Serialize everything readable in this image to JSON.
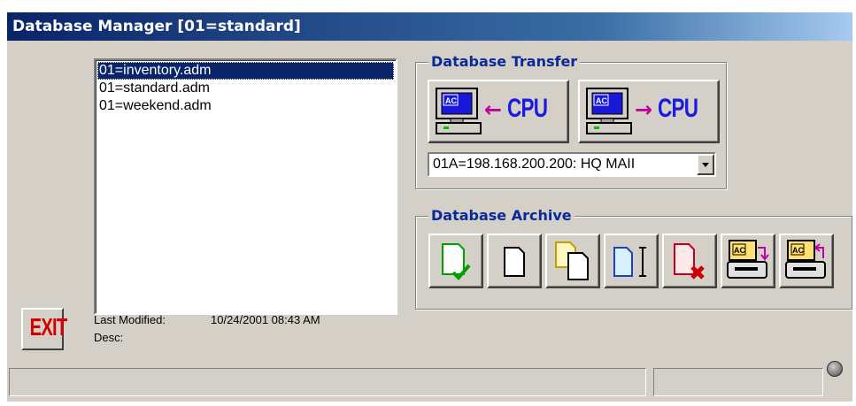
{
  "window": {
    "title": "Database Manager  [01=standard]"
  },
  "file_list": {
    "items": [
      {
        "label": "01=inventory.adm",
        "selected": true
      },
      {
        "label": "01=standard.adm",
        "selected": false
      },
      {
        "label": "01=weekend.adm",
        "selected": false
      }
    ]
  },
  "transfer": {
    "group_label": "Database Transfer",
    "to_pc_text": "CPU",
    "to_cpu_text": "CPU",
    "pc_screen_text": "AC",
    "target_select": {
      "value": "01A=198.168.200.200: HQ MAII"
    }
  },
  "archive": {
    "group_label": "Database Archive",
    "disk_label": "AC"
  },
  "exit": {
    "label": "EXIT"
  },
  "info": {
    "last_modified_label": "Last Modified:",
    "last_modified_value": "10/24/2001 08:43 AM",
    "desc_label": "Desc:",
    "desc_value": ""
  },
  "status": {
    "main_text": "",
    "secondary_text": ""
  },
  "colors": {
    "title_bar": "#0a246a",
    "group_label": "#0a2a9a",
    "cpu_text": "#1a1ae0",
    "arrow": "#c000a0",
    "exit_text": "#d40000"
  }
}
